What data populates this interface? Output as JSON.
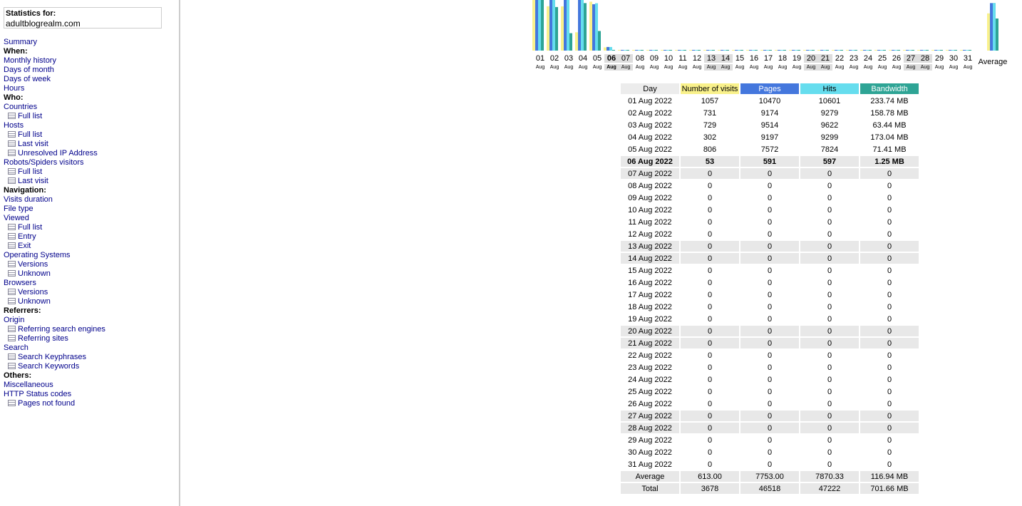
{
  "sidebar": {
    "stats_label": "Statistics for:",
    "site": "adultblogrealm.com",
    "menu": [
      {
        "type": "link",
        "label": "Summary"
      },
      {
        "type": "head",
        "label": "When:"
      },
      {
        "type": "link",
        "label": "Monthly history"
      },
      {
        "type": "link",
        "label": "Days of month"
      },
      {
        "type": "link",
        "label": "Days of week"
      },
      {
        "type": "link",
        "label": "Hours"
      },
      {
        "type": "head",
        "label": "Who:"
      },
      {
        "type": "link",
        "label": "Countries"
      },
      {
        "type": "sub",
        "label": "Full list"
      },
      {
        "type": "link",
        "label": "Hosts"
      },
      {
        "type": "sub",
        "label": "Full list"
      },
      {
        "type": "sub",
        "label": "Last visit"
      },
      {
        "type": "sub",
        "label": "Unresolved IP Address"
      },
      {
        "type": "link",
        "label": "Robots/Spiders visitors"
      },
      {
        "type": "sub",
        "label": "Full list"
      },
      {
        "type": "sub",
        "label": "Last visit"
      },
      {
        "type": "head",
        "label": "Navigation:"
      },
      {
        "type": "link",
        "label": "Visits duration"
      },
      {
        "type": "link",
        "label": "File type"
      },
      {
        "type": "link",
        "label": "Viewed"
      },
      {
        "type": "sub",
        "label": "Full list"
      },
      {
        "type": "sub",
        "label": "Entry"
      },
      {
        "type": "sub",
        "label": "Exit"
      },
      {
        "type": "link",
        "label": "Operating Systems"
      },
      {
        "type": "sub",
        "label": "Versions"
      },
      {
        "type": "sub",
        "label": "Unknown"
      },
      {
        "type": "link",
        "label": "Browsers"
      },
      {
        "type": "sub",
        "label": "Versions"
      },
      {
        "type": "sub",
        "label": "Unknown"
      },
      {
        "type": "head",
        "label": "Referrers:"
      },
      {
        "type": "link",
        "label": "Origin"
      },
      {
        "type": "sub",
        "label": "Referring search engines"
      },
      {
        "type": "sub",
        "label": "Referring sites"
      },
      {
        "type": "link",
        "label": "Search"
      },
      {
        "type": "sub",
        "label": "Search Keyphrases"
      },
      {
        "type": "sub",
        "label": "Search Keywords"
      },
      {
        "type": "head",
        "label": "Others:"
      },
      {
        "type": "link",
        "label": "Miscellaneous"
      },
      {
        "type": "link",
        "label": "HTTP Status codes"
      },
      {
        "type": "sub",
        "label": "Pages not found"
      }
    ]
  },
  "colors": {
    "visits": "#f9f18b",
    "pages": "#4477dd",
    "hits": "#66ddee",
    "bandwidth": "#2ea495"
  },
  "chart_data": {
    "type": "bar",
    "categories": [
      "01",
      "02",
      "03",
      "04",
      "05",
      "06",
      "07",
      "08",
      "09",
      "10",
      "11",
      "12",
      "13",
      "14",
      "15",
      "16",
      "17",
      "18",
      "19",
      "20",
      "21",
      "22",
      "23",
      "24",
      "25",
      "26",
      "27",
      "28",
      "29",
      "30",
      "31"
    ],
    "month_label": "Aug",
    "today": "06",
    "weekend": [
      "06",
      "07",
      "13",
      "14",
      "20",
      "21",
      "27",
      "28"
    ],
    "average_label": "Average",
    "series": [
      {
        "name": "Number of visits",
        "values": [
          1057,
          731,
          729,
          302,
          806,
          53,
          0,
          0,
          0,
          0,
          0,
          0,
          0,
          0,
          0,
          0,
          0,
          0,
          0,
          0,
          0,
          0,
          0,
          0,
          0,
          0,
          0,
          0,
          0,
          0,
          0
        ],
        "average": 613.0
      },
      {
        "name": "Pages",
        "values": [
          10470,
          9174,
          9514,
          9197,
          7572,
          591,
          0,
          0,
          0,
          0,
          0,
          0,
          0,
          0,
          0,
          0,
          0,
          0,
          0,
          0,
          0,
          0,
          0,
          0,
          0,
          0,
          0,
          0,
          0,
          0,
          0
        ],
        "average": 7753.0
      },
      {
        "name": "Hits",
        "values": [
          10601,
          9279,
          9622,
          9299,
          7824,
          597,
          0,
          0,
          0,
          0,
          0,
          0,
          0,
          0,
          0,
          0,
          0,
          0,
          0,
          0,
          0,
          0,
          0,
          0,
          0,
          0,
          0,
          0,
          0,
          0,
          0
        ],
        "average": 7870.33
      },
      {
        "name": "Bandwidth",
        "values": [
          233.74,
          158.78,
          63.44,
          173.04,
          71.41,
          1.25,
          0,
          0,
          0,
          0,
          0,
          0,
          0,
          0,
          0,
          0,
          0,
          0,
          0,
          0,
          0,
          0,
          0,
          0,
          0,
          0,
          0,
          0,
          0,
          0,
          0
        ],
        "average": 116.94
      }
    ]
  },
  "table": {
    "headers": [
      "Day",
      "Number of visits",
      "Pages",
      "Hits",
      "Bandwidth"
    ],
    "rows": [
      [
        "01 Aug 2022",
        "1057",
        "10470",
        "10601",
        "233.74 MB"
      ],
      [
        "02 Aug 2022",
        "731",
        "9174",
        "9279",
        "158.78 MB"
      ],
      [
        "03 Aug 2022",
        "729",
        "9514",
        "9622",
        "63.44 MB"
      ],
      [
        "04 Aug 2022",
        "302",
        "9197",
        "9299",
        "173.04 MB"
      ],
      [
        "05 Aug 2022",
        "806",
        "7572",
        "7824",
        "71.41 MB"
      ],
      [
        "06 Aug 2022",
        "53",
        "591",
        "597",
        "1.25 MB"
      ],
      [
        "07 Aug 2022",
        "0",
        "0",
        "0",
        "0"
      ],
      [
        "08 Aug 2022",
        "0",
        "0",
        "0",
        "0"
      ],
      [
        "09 Aug 2022",
        "0",
        "0",
        "0",
        "0"
      ],
      [
        "10 Aug 2022",
        "0",
        "0",
        "0",
        "0"
      ],
      [
        "11 Aug 2022",
        "0",
        "0",
        "0",
        "0"
      ],
      [
        "12 Aug 2022",
        "0",
        "0",
        "0",
        "0"
      ],
      [
        "13 Aug 2022",
        "0",
        "0",
        "0",
        "0"
      ],
      [
        "14 Aug 2022",
        "0",
        "0",
        "0",
        "0"
      ],
      [
        "15 Aug 2022",
        "0",
        "0",
        "0",
        "0"
      ],
      [
        "16 Aug 2022",
        "0",
        "0",
        "0",
        "0"
      ],
      [
        "17 Aug 2022",
        "0",
        "0",
        "0",
        "0"
      ],
      [
        "18 Aug 2022",
        "0",
        "0",
        "0",
        "0"
      ],
      [
        "19 Aug 2022",
        "0",
        "0",
        "0",
        "0"
      ],
      [
        "20 Aug 2022",
        "0",
        "0",
        "0",
        "0"
      ],
      [
        "21 Aug 2022",
        "0",
        "0",
        "0",
        "0"
      ],
      [
        "22 Aug 2022",
        "0",
        "0",
        "0",
        "0"
      ],
      [
        "23 Aug 2022",
        "0",
        "0",
        "0",
        "0"
      ],
      [
        "24 Aug 2022",
        "0",
        "0",
        "0",
        "0"
      ],
      [
        "25 Aug 2022",
        "0",
        "0",
        "0",
        "0"
      ],
      [
        "26 Aug 2022",
        "0",
        "0",
        "0",
        "0"
      ],
      [
        "27 Aug 2022",
        "0",
        "0",
        "0",
        "0"
      ],
      [
        "28 Aug 2022",
        "0",
        "0",
        "0",
        "0"
      ],
      [
        "29 Aug 2022",
        "0",
        "0",
        "0",
        "0"
      ],
      [
        "30 Aug 2022",
        "0",
        "0",
        "0",
        "0"
      ],
      [
        "31 Aug 2022",
        "0",
        "0",
        "0",
        "0"
      ]
    ],
    "highlight_rows": [
      5,
      6,
      12,
      13,
      19,
      20,
      26,
      27
    ],
    "bold_row": 5,
    "average_row": [
      "Average",
      "613.00",
      "7753.00",
      "7870.33",
      "116.94 MB"
    ],
    "total_row": [
      "Total",
      "3678",
      "46518",
      "47222",
      "701.66 MB"
    ]
  }
}
